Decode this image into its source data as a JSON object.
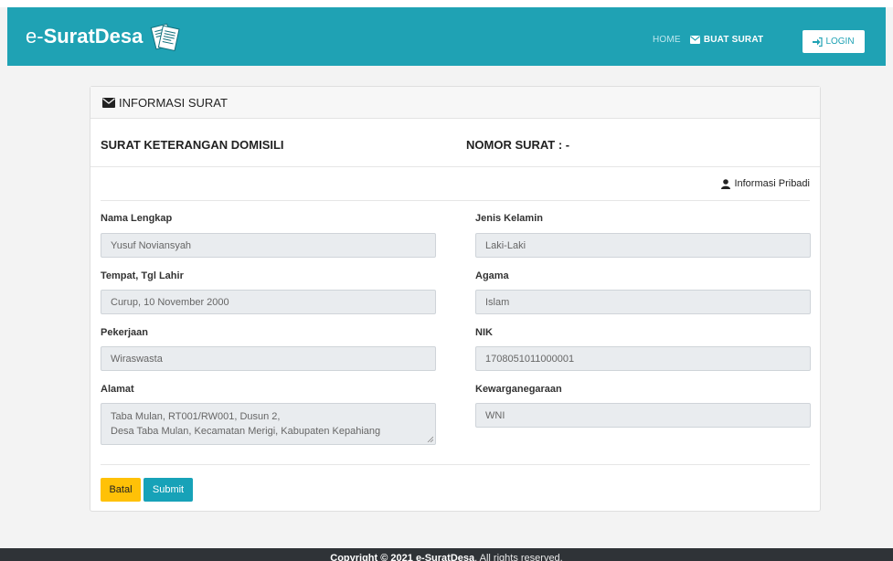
{
  "navbar": {
    "brand_prefix": "e-",
    "brand_main": "SuratDesa",
    "brand_icon": "documents-icon",
    "home_label": "HOME",
    "buat_surat_label": "BUAT SURAT",
    "login_label": "LOGIN",
    "color": "#1fa2b4"
  },
  "card": {
    "header_title": "INFORMASI SURAT",
    "surat_title": "SURAT KETERANGAN DOMISILI",
    "nomor_surat": "NOMOR SURAT : -",
    "section_label": "Informasi Pribadi"
  },
  "form": {
    "nama_label": "Nama Lengkap",
    "nama_value": "Yusuf Noviansyah",
    "ttl_label": "Tempat, Tgl Lahir",
    "ttl_value": "Curup, 10 November 2000",
    "pekerjaan_label": "Pekerjaan",
    "pekerjaan_value": "Wiraswasta",
    "alamat_label": "Alamat",
    "alamat_line1": "Taba Mulan, RT001/RW001, Dusun 2,",
    "alamat_line2": "Desa Taba Mulan, Kecamatan Merigi, Kabupaten Kepahiang",
    "jk_label": "Jenis Kelamin",
    "jk_value": "Laki-Laki",
    "agama_label": "Agama",
    "agama_value": "Islam",
    "nik_label": "NIK",
    "nik_value": "1708051011000001",
    "kwn_label": "Kewarganegaraan",
    "kwn_value": "WNI"
  },
  "buttons": {
    "batal": "Batal",
    "submit": "Submit"
  },
  "footer": {
    "pre": "Copyright © 2021 ",
    "brand": "e-SuratDesa",
    "post": ". All rights reserved."
  }
}
